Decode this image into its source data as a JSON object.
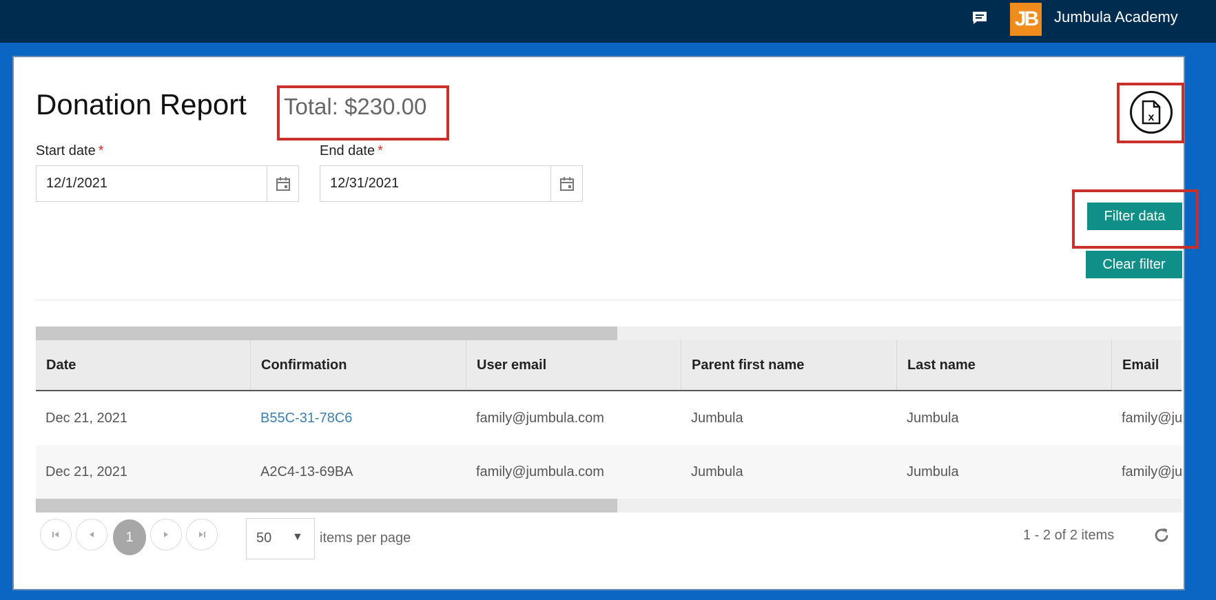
{
  "header": {
    "org_name": "Jumbula Academy",
    "logo_text": "JB",
    "icons": [
      "chat-icon"
    ]
  },
  "report": {
    "title": "Donation Report",
    "total": "Total: $230.00",
    "export_icon": "excel-export-icon"
  },
  "filters": {
    "start_label": "Start date",
    "end_label": "End date",
    "required_mark": "*",
    "start_value": "12/1/2021",
    "end_value": "12/31/2021",
    "filter_button": "Filter data",
    "clear_button": "Clear filter"
  },
  "table": {
    "columns": [
      "Date",
      "Confirmation",
      "User email",
      "Parent first name",
      "Last name",
      "Email"
    ],
    "rows": [
      [
        "Dec 21, 2021",
        "B55C-31-78C6",
        "family@jumbula.com",
        "Jumbula",
        "Jumbula",
        "family@ju"
      ],
      [
        "Dec 21, 2021",
        "A2C4-13-69BA",
        "family@jumbula.com",
        "Jumbula",
        "Jumbula",
        "family@ju"
      ]
    ]
  },
  "pagination": {
    "current_page": "1",
    "page_size": "50",
    "per_page_label": "items per page",
    "info": "1 - 2 of 2 items"
  },
  "colors": {
    "topbar": "#002d4f",
    "frame": "#0b66c3",
    "accent": "#108f88",
    "highlight": "#c9302c",
    "logo": "#f08c1c"
  }
}
